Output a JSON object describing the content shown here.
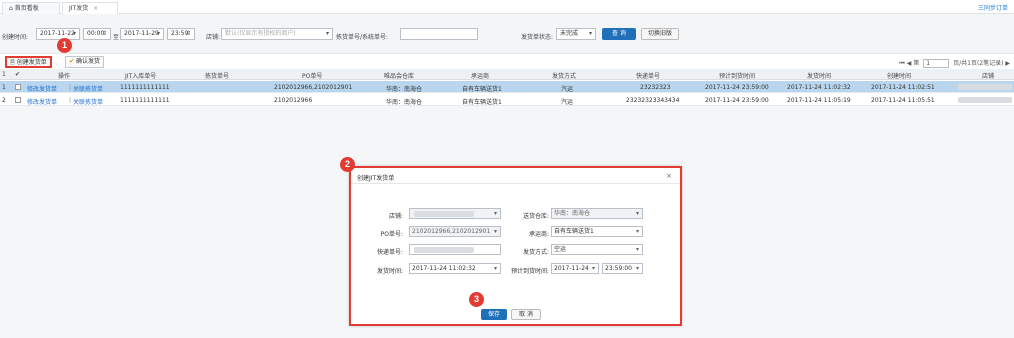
{
  "tabs": {
    "home": "首页看板",
    "home_icon": "home-icon",
    "active": "JIT发货",
    "sync": "三同步订单"
  },
  "filter": {
    "create_time_label": "创建时间:",
    "start_date": "2017-11-22",
    "start_time": "00:00",
    "to": "至",
    "end_date": "2017-11-29",
    "end_time": "23:59",
    "shop_label": "店铺:",
    "shop_placeholder": "默认(仅显示有授权的商户)",
    "order_no_label": "拣货单号/系统单号:",
    "order_no_value": "",
    "status_label": "发货单状态:",
    "status_value": "未完成",
    "query_btn": "查 询",
    "switch_btn": "切换旧版"
  },
  "toolbar": {
    "create_btn": "创建发货单",
    "confirm_btn": "确认发货"
  },
  "pager": {
    "first": "⏮",
    "prev": "◀",
    "page_label": "第",
    "page": "1",
    "info": "页/共1页(2笔记录)",
    "next": "▶"
  },
  "table": {
    "headers": [
      "操作",
      "JIT入库单号",
      "拣货单号",
      "PO单号",
      "唯品会仓库",
      "承运商",
      "发货方式",
      "快递单号",
      "预计到货时间",
      "发货时间",
      "创建时间",
      "店铺"
    ],
    "rows": [
      {
        "no": "1",
        "op1": "修改发货单",
        "op2": "关联拣货单",
        "jit": "1111111111111",
        "pick": "",
        "po": "2102012966,2102012901",
        "wh": "华南：南海仓",
        "carrier": "自有车辆送货1",
        "method": "汽运",
        "express": "23232323",
        "eta": "2017-11-24 23:59:00",
        "ship": "2017-11-24 11:02:32",
        "created": "2017-11-24 11:02:51"
      },
      {
        "no": "2",
        "op1": "修改发货单",
        "op2": "关联拣货单",
        "jit": "1111111111111",
        "pick": "",
        "po": "2102012966",
        "wh": "华南：南海仓",
        "carrier": "自有车辆送货1",
        "method": "汽运",
        "express": "23232323343434",
        "eta": "2017-11-24 23:59:00",
        "ship": "2017-11-24 11:05:19",
        "created": "2017-11-24 11:05:51"
      }
    ]
  },
  "modal": {
    "title": "创建JIT发货单",
    "shop_label": "店铺:",
    "shop_value": "",
    "wh_label": "送货仓库:",
    "wh_value": "华南：南海仓",
    "po_label": "PO单号:",
    "po_value": "2102012966,2102012901",
    "carrier_label": "承运商:",
    "carrier_value": "自有车辆送货1",
    "express_label": "快递单号:",
    "express_value": "",
    "method_label": "发货方式:",
    "method_value": "空运",
    "ship_label": "发货时间:",
    "ship_value": "2017-11-24 11:02:32",
    "eta_label": "预计到货时间:",
    "eta_date": "2017-11-24",
    "eta_time": "23:59:00",
    "save_btn": "保存",
    "cancel_btn": "取 消"
  },
  "markers": [
    "1",
    "2",
    "3"
  ],
  "colors": {
    "accent": "#1f6fb9",
    "marker": "#e23b32",
    "selected_row": "#b9d6ee"
  }
}
